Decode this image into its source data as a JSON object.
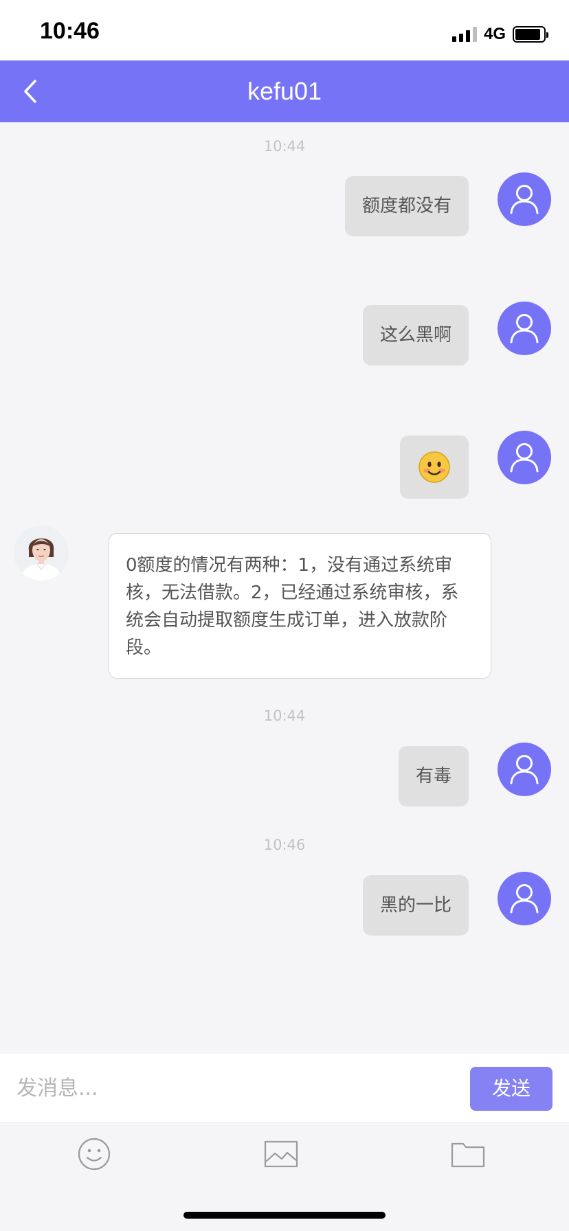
{
  "status_bar": {
    "time": "10:46",
    "network": "4G"
  },
  "header": {
    "title": "kefu01"
  },
  "messages": [
    {
      "type": "time",
      "text": "10:44"
    },
    {
      "type": "out",
      "text": "额度都没有"
    },
    {
      "type": "out",
      "text": "这么黑啊"
    },
    {
      "type": "out_emoji",
      "icon": "smiling-face-emoji"
    },
    {
      "type": "in",
      "text": "0额度的情况有两种：1，没有通过系统审核，无法借款。2，已经通过系统审核，系统会自动提取额度生成订单，进入放款阶段。"
    },
    {
      "type": "time",
      "text": "10:44"
    },
    {
      "type": "out",
      "text": "有毒"
    },
    {
      "type": "time",
      "text": "10:46"
    },
    {
      "type": "out",
      "text": "黑的一比"
    }
  ],
  "input_bar": {
    "placeholder": "发消息...",
    "send_label": "发送"
  },
  "toolbar": {
    "icons": [
      "emoji-icon",
      "image-icon",
      "folder-icon"
    ]
  },
  "colors": {
    "accent": "#7673f6",
    "send_button": "#8583f3",
    "bubble_out": "#e0e0e0",
    "bubble_in": "#ffffff",
    "background": "#f5f5f7"
  }
}
